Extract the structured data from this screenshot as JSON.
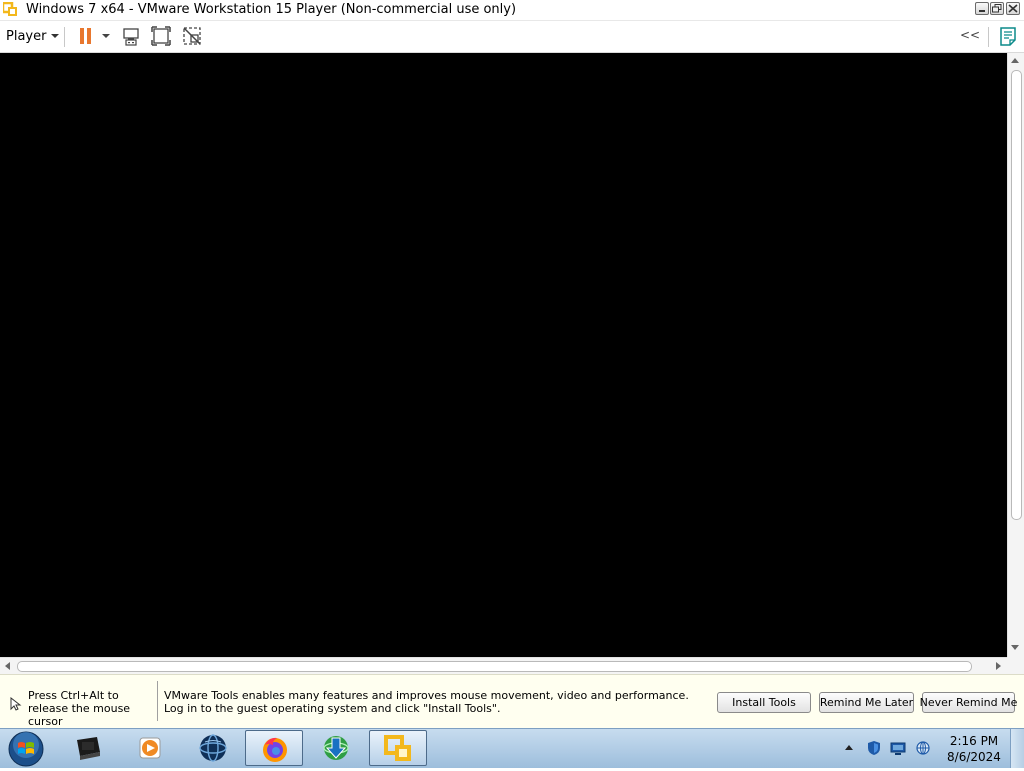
{
  "window": {
    "title": "Windows 7 x64 - VMware Workstation 15 Player (Non-commercial use only)"
  },
  "toolbar": {
    "player_menu_label": "Player",
    "collapse_label": "<<"
  },
  "notification": {
    "release_text": "Press Ctrl+Alt to release the mouse cursor",
    "tools_message": "VMware Tools enables many features and improves mouse movement, video and performance. Log in to the guest operating system and click \"Install Tools\".",
    "install_tools_label": "Install Tools",
    "remind_later_label": "Remind Me Later",
    "never_remind_label": "Never Remind Me"
  },
  "taskbar": {
    "pinned": [
      {
        "name": "computer-icon"
      },
      {
        "name": "media-player-icon"
      },
      {
        "name": "network-globe-icon"
      },
      {
        "name": "firefox-icon"
      },
      {
        "name": "internet-download-manager-icon"
      },
      {
        "name": "vmware-player-icon",
        "active": true
      }
    ],
    "tray_icons": [
      "shield-icon",
      "display-icon",
      "network-icon"
    ],
    "clock_time": "2:16 PM",
    "clock_date": "8/6/2024"
  },
  "colors": {
    "vm_background": "#000000",
    "pause_orange": "#e8772e",
    "notification_bg": "#fffff0",
    "vmware_yellow": "#f3b81c"
  }
}
